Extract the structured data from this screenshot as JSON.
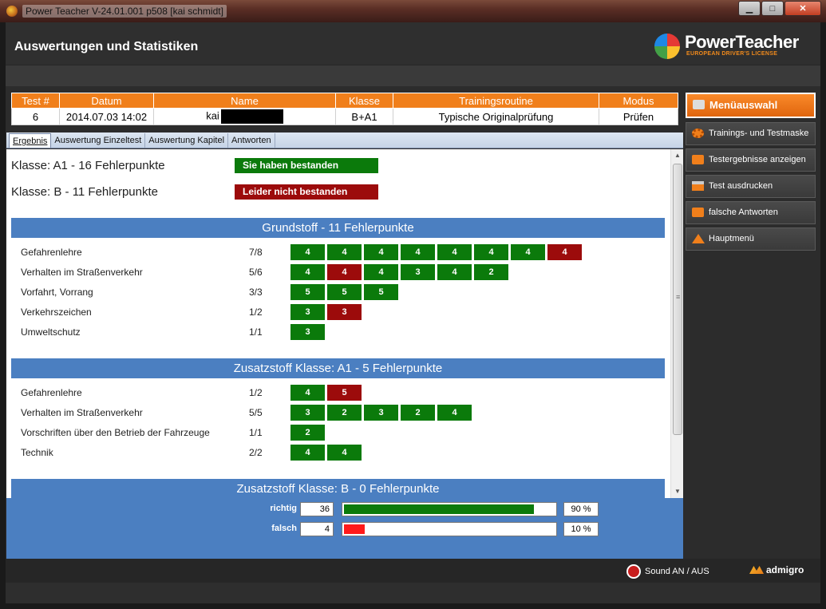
{
  "window": {
    "title": "Power Teacher V-24.01.001 p508 [kai schmidt]",
    "minimize": "▁",
    "maximize": "□",
    "close": "✕"
  },
  "header": {
    "title": "Auswertungen und Statistiken",
    "logo_brand": "PowerTeacher",
    "logo_tag": "EUROPEAN DRIVER'S LICENSE"
  },
  "info": {
    "headers": [
      "Test #",
      "Datum",
      "Name",
      "Klasse",
      "Trainingsroutine",
      "Modus"
    ],
    "values": {
      "test": "6",
      "datum": "2014.07.03 14:02",
      "name": "kai",
      "klasse": "B+A1",
      "routine": "Typische Originalprüfung",
      "modus": "Prüfen"
    }
  },
  "tabs": [
    "Ergebnis",
    "Auswertung Einzeltest",
    "Auswertung Kapitel",
    "Antworten"
  ],
  "results": [
    {
      "text": "Klasse: A1 - 16 Fehlerpunkte",
      "badge": "Sie haben bestanden",
      "status": "pass"
    },
    {
      "text": "Klasse: B - 11 Fehlerpunkte",
      "badge": "Leider nicht bestanden",
      "status": "fail"
    }
  ],
  "sections": [
    {
      "title": "Grundstoff - 11 Fehlerpunkte",
      "rows": [
        {
          "topic": "Gefahrenlehre",
          "score": "7/8",
          "cells": [
            {
              "v": "4",
              "s": "g"
            },
            {
              "v": "4",
              "s": "g"
            },
            {
              "v": "4",
              "s": "g"
            },
            {
              "v": "4",
              "s": "g"
            },
            {
              "v": "4",
              "s": "g"
            },
            {
              "v": "4",
              "s": "g"
            },
            {
              "v": "4",
              "s": "g"
            },
            {
              "v": "4",
              "s": "r"
            }
          ]
        },
        {
          "topic": "Verhalten im Straßenverkehr",
          "score": "5/6",
          "cells": [
            {
              "v": "4",
              "s": "g"
            },
            {
              "v": "4",
              "s": "r"
            },
            {
              "v": "4",
              "s": "g"
            },
            {
              "v": "3",
              "s": "g"
            },
            {
              "v": "4",
              "s": "g"
            },
            {
              "v": "2",
              "s": "g"
            }
          ]
        },
        {
          "topic": "Vorfahrt, Vorrang",
          "score": "3/3",
          "cells": [
            {
              "v": "5",
              "s": "g"
            },
            {
              "v": "5",
              "s": "g"
            },
            {
              "v": "5",
              "s": "g"
            }
          ]
        },
        {
          "topic": "Verkehrszeichen",
          "score": "1/2",
          "cells": [
            {
              "v": "3",
              "s": "g"
            },
            {
              "v": "3",
              "s": "r"
            }
          ]
        },
        {
          "topic": "Umweltschutz",
          "score": "1/1",
          "cells": [
            {
              "v": "3",
              "s": "g"
            }
          ]
        }
      ]
    },
    {
      "title": "Zusatzstoff Klasse: A1 - 5 Fehlerpunkte",
      "rows": [
        {
          "topic": "Gefahrenlehre",
          "score": "1/2",
          "cells": [
            {
              "v": "4",
              "s": "g"
            },
            {
              "v": "5",
              "s": "r"
            }
          ]
        },
        {
          "topic": "Verhalten im Straßenverkehr",
          "score": "5/5",
          "cells": [
            {
              "v": "3",
              "s": "g"
            },
            {
              "v": "2",
              "s": "g"
            },
            {
              "v": "3",
              "s": "g"
            },
            {
              "v": "2",
              "s": "g"
            },
            {
              "v": "4",
              "s": "g"
            }
          ]
        },
        {
          "topic": "Vorschriften über den Betrieb der Fahrzeuge",
          "score": "1/1",
          "cells": [
            {
              "v": "2",
              "s": "g"
            }
          ]
        },
        {
          "topic": "Technik",
          "score": "2/2",
          "cells": [
            {
              "v": "4",
              "s": "g"
            },
            {
              "v": "4",
              "s": "g"
            }
          ]
        }
      ]
    },
    {
      "title": "Zusatzstoff Klasse: B - 0 Fehlerpunkte",
      "rows": []
    }
  ],
  "stats": [
    {
      "label": "richtig",
      "count": "36",
      "percent": "90 %",
      "fraction": 0.9,
      "color": "#0b7a0b"
    },
    {
      "label": "falsch",
      "count": "4",
      "percent": "10 %",
      "fraction": 0.1,
      "color": "#ff1a1a"
    }
  ],
  "menu": [
    {
      "label": "Menüauswahl",
      "icon": "folder-white-icon",
      "primary": true
    },
    {
      "label": "Trainings- und Testmaske",
      "icon": "gear-icon"
    },
    {
      "label": "Testergebnisse anzeigen",
      "icon": "folder-icon"
    },
    {
      "label": "Test ausdrucken",
      "icon": "printer-icon"
    },
    {
      "label": "falsche Antworten",
      "icon": "folder-icon"
    },
    {
      "label": "Hauptmenü",
      "icon": "house-icon"
    }
  ],
  "footer": {
    "sound": "Sound AN / AUS",
    "brand": "admigro"
  }
}
